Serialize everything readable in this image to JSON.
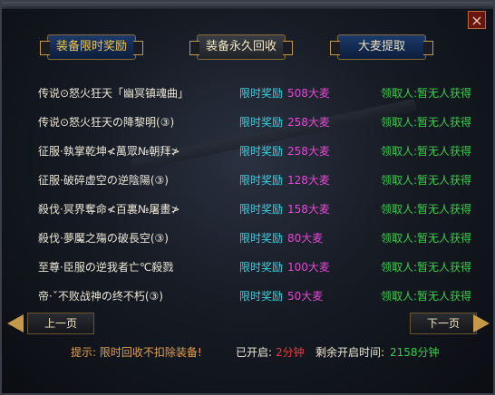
{
  "tabs": [
    {
      "label": "装备限时奖励",
      "state": "active"
    },
    {
      "label": "装备永久回收",
      "state": "normal"
    },
    {
      "label": "大麦提取",
      "state": "normal"
    }
  ],
  "close_icon": "×",
  "rows": [
    {
      "name": "传说⊙怒火狂天「幽冥镇魂曲」",
      "tag": "限时奖励",
      "amount": "508大麦",
      "receiver": "领取人:暂无人获得"
    },
    {
      "name": "传说⊙怒火狂天の降黎明(③)",
      "tag": "限时奖励",
      "amount": "258大麦",
      "receiver": "领取人:暂无人获得"
    },
    {
      "name": "征服·執掌乾坤≮萬眾№朝拜≯",
      "tag": "限时奖励",
      "amount": "258大麦",
      "receiver": "领取人:暂无人获得"
    },
    {
      "name": "征服·破碎虚空の逆陰陽(③)",
      "tag": "限时奖励",
      "amount": "128大麦",
      "receiver": "领取人:暂无人获得"
    },
    {
      "name": "殺伐·冥界奪命≮百裏№屠畫≯",
      "tag": "限时奖励",
      "amount": "158大麦",
      "receiver": "领取人:暂无人获得"
    },
    {
      "name": "殺伐·夢魘之殤の破長空(③)",
      "tag": "限时奖励",
      "amount": "80大麦",
      "receiver": "领取人:暂无人获得"
    },
    {
      "name": "至尊·臣服の逆我者亡℃殺戮",
      "tag": "限时奖励",
      "amount": "100大麦",
      "receiver": "领取人:暂无人获得"
    },
    {
      "name": "帝·ˇ不败战神の终不朽(③)",
      "tag": "限时奖励",
      "amount": "50大麦",
      "receiver": "领取人:暂无人获得"
    }
  ],
  "pager": {
    "prev": "上一页",
    "next": "下一页"
  },
  "footer": {
    "tip": "提示: 限时回收不扣除装备!",
    "opened_label": "已开启:",
    "opened_value": "2分钟",
    "remain_label": "剩余开启时间:",
    "remain_value": "2158分钟"
  }
}
